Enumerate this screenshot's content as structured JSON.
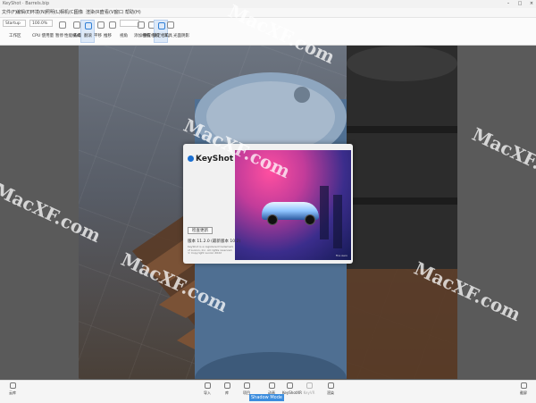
{
  "window": {
    "title": "KeyShot  ·  Barrels.bip",
    "min": "–",
    "max": "□",
    "close": "×"
  },
  "menu": [
    "文件(F)",
    "编辑(E)",
    "环境(N)",
    "照明(L)",
    "相机(C)",
    "图像",
    "渲染(R)",
    "查看(V)",
    "窗口",
    "帮助(H)"
  ],
  "ribbon": {
    "workspace_value": "Startup",
    "zoom_value": "100.0%",
    "fps_value": "",
    "labels": [
      "工作区",
      "CPU 使用量",
      "暂停",
      "性能模式",
      "去噪",
      "翻滚",
      "平移",
      "推移",
      "视角",
      "添加相机",
      "重置相机",
      "锁定相机",
      "工具",
      "光面阴影"
    ]
  },
  "splash": {
    "brand": "KeyShot",
    "button": "检查更新",
    "version": "版本 11.2.0 (最新版本 10.2)",
    "copyright_lines": [
      "KeyShot is a registered trademark",
      "of Luxion, Inc. All rights reserved.",
      "© Copyright Luxion 2022"
    ],
    "art_credit": "Fire Aero"
  },
  "bottom": {
    "left": "云库",
    "items": [
      "导入",
      "库",
      "项目",
      "动画",
      "KeyShotXR",
      "KeyVR",
      "渲染"
    ],
    "right": "截屏",
    "shadow_mode": "Shadow Mode"
  },
  "watermark": "MacXF.com",
  "colors": {
    "accent": "#3c8dde",
    "brand_mark": "#1a6fd1"
  }
}
